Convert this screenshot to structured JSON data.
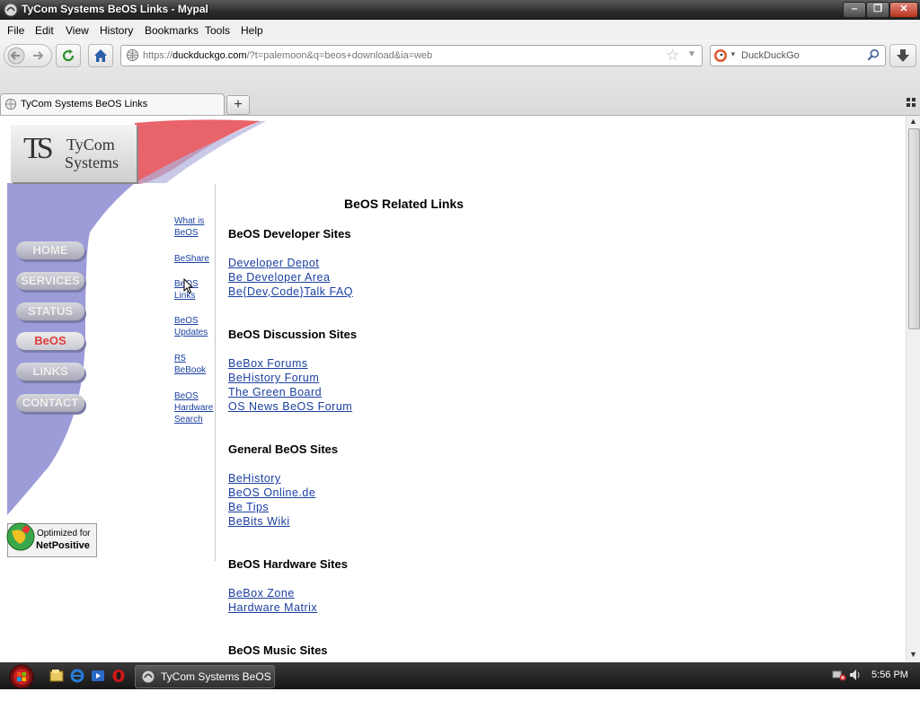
{
  "window": {
    "title": "TyCom Systems BeOS Links - Mypal",
    "min_glyph": "‒",
    "max_glyph": "❐",
    "close_glyph": "✕"
  },
  "menu": [
    "File",
    "Edit",
    "View",
    "History",
    "Bookmarks",
    "Tools",
    "Help"
  ],
  "nav": {
    "url_prefix": "https://",
    "url_domain": "duckduckgo.com",
    "url_rest": "/?t=palemoon&q=beos+download&ia=web",
    "search_engine": "DuckDuckGo"
  },
  "tab": {
    "title": "TyCom Systems BeOS Links",
    "new_tab_glyph": "+"
  },
  "site": {
    "logo_line1": "TyCom",
    "logo_line2": "Systems",
    "logo_mark": "TS",
    "main_nav": [
      {
        "label": "HOME",
        "active": false
      },
      {
        "label": "SERVICES",
        "active": false
      },
      {
        "label": "STATUS",
        "active": false
      },
      {
        "label": "BeOS",
        "active": true
      },
      {
        "label": "LINKS",
        "active": false
      },
      {
        "label": "CONTACT",
        "active": false
      }
    ],
    "sub_nav": [
      {
        "line1": "What is",
        "line2": "BeOS"
      },
      {
        "line1": "BeShare",
        "line2": ""
      },
      {
        "line1": "BeOS",
        "line2": "Links"
      },
      {
        "line1": "BeOS",
        "line2": "Updates"
      },
      {
        "line1": "R5",
        "line2": "BeBook"
      },
      {
        "line1": "BeOS",
        "line2": "Hardware",
        "line3": "Search"
      }
    ],
    "badge_line1": "Optimized for",
    "badge_line2": "NetPositive",
    "main_title": "BeOS Related Links",
    "sections": [
      {
        "heading": "BeOS Developer Sites",
        "links": [
          "Developer Depot",
          "Be Developer Area",
          "Be{Dev,Code}Talk FAQ"
        ]
      },
      {
        "heading": "BeOS Discussion Sites",
        "links": [
          "BeBox Forums",
          "BeHistory Forum",
          "The Green Board",
          "OS News BeOS Forum"
        ]
      },
      {
        "heading": "General BeOS Sites",
        "links": [
          "BeHistory",
          "BeOS Online.de",
          "Be Tips",
          "BeBits Wiki"
        ]
      },
      {
        "heading": "BeOS Hardware Sites",
        "links": [
          "BeBox Zone",
          "Hardware Matrix"
        ]
      },
      {
        "heading": "BeOS Music Sites",
        "links": []
      }
    ]
  },
  "taskbar": {
    "task_label": "TyCom Systems BeOS ...",
    "clock": "5:56 PM"
  },
  "colors": {
    "link": "#1a3fa0",
    "nav_purple": "#9c9cd8",
    "nav_red": "#e8646a",
    "active_nav_text": "#e03c3c"
  }
}
